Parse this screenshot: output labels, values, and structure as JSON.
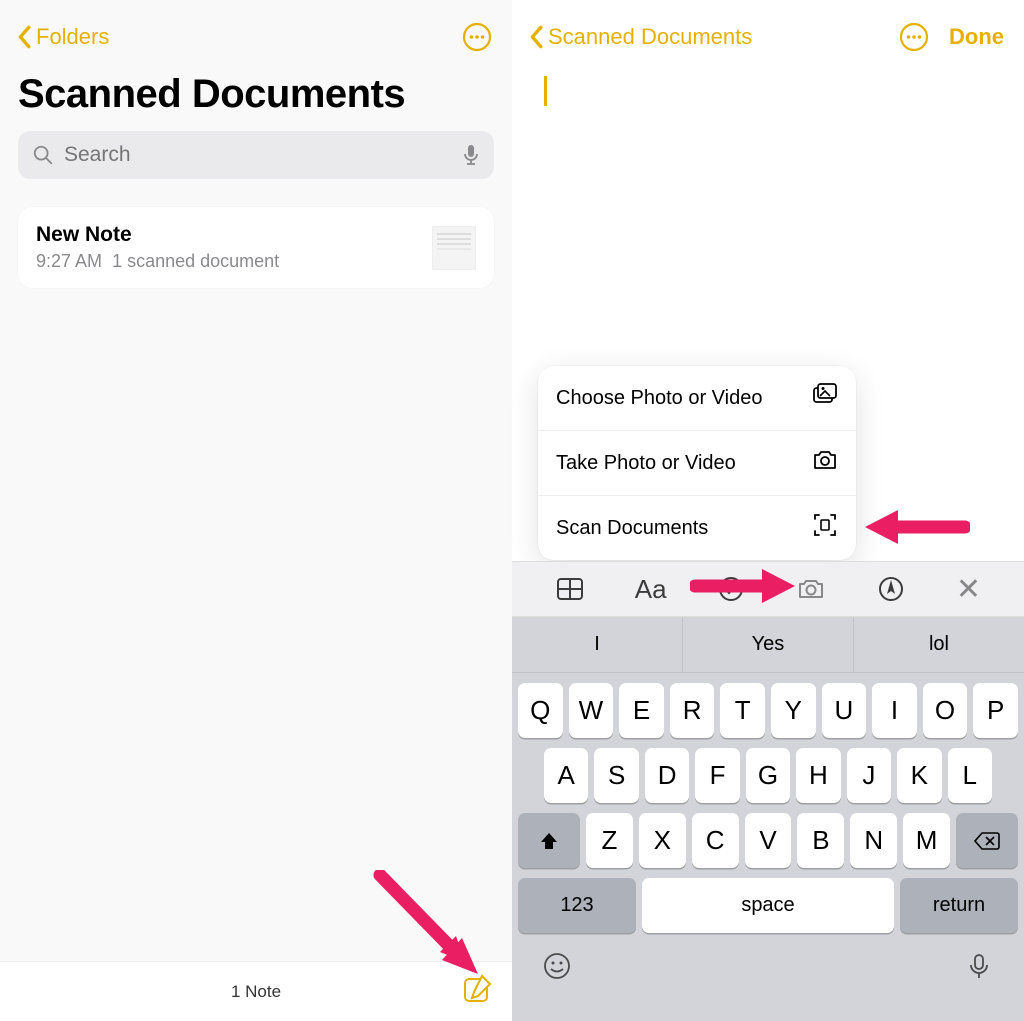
{
  "colors": {
    "accent": "#e4b100",
    "arrow": "#e91e63"
  },
  "left": {
    "back_label": "Folders",
    "title": "Scanned Documents",
    "search_placeholder": "Search",
    "note": {
      "title": "New Note",
      "time": "9:27 AM",
      "detail": "1 scanned document"
    },
    "footer_count": "1 Note"
  },
  "right": {
    "back_label": "Scanned Documents",
    "done_label": "Done",
    "menu": {
      "choose": "Choose Photo or Video",
      "take": "Take Photo or Video",
      "scan": "Scan Documents"
    },
    "format_bar": {
      "aa": "Aa"
    },
    "suggestions": [
      "I",
      "Yes",
      "lol"
    ],
    "keyboard": {
      "row1": [
        "Q",
        "W",
        "E",
        "R",
        "T",
        "Y",
        "U",
        "I",
        "O",
        "P"
      ],
      "row2": [
        "A",
        "S",
        "D",
        "F",
        "G",
        "H",
        "J",
        "K",
        "L"
      ],
      "row3": [
        "Z",
        "X",
        "C",
        "V",
        "B",
        "N",
        "M"
      ],
      "num": "123",
      "space": "space",
      "return": "return"
    }
  }
}
